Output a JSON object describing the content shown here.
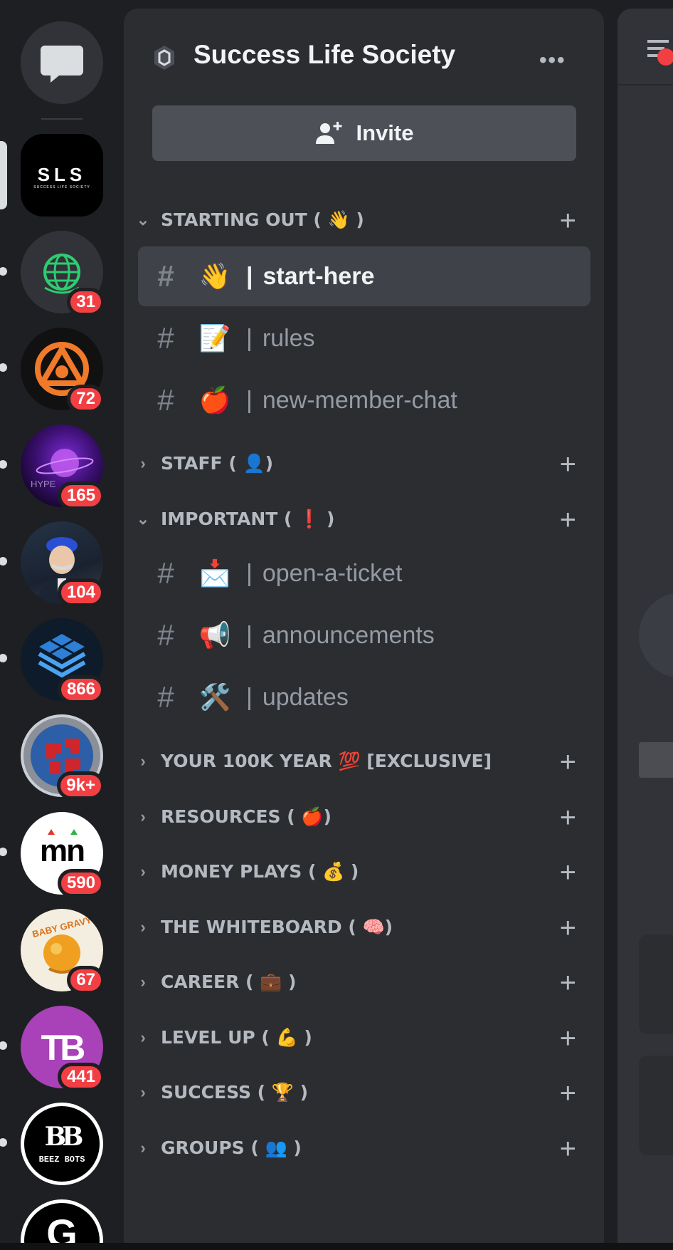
{
  "server": {
    "name": "Success Life Society",
    "invite_label": "Invite"
  },
  "rail": {
    "items": [
      {
        "name": "direct-messages",
        "badge": ""
      },
      {
        "name": "SLS",
        "title": "SLS",
        "subtitle": "SUCCESS LIFE SOCIETY",
        "badge": ""
      },
      {
        "name": "globe-server",
        "badge": "31"
      },
      {
        "name": "triangle-server",
        "badge": "72"
      },
      {
        "name": "hype-server",
        "label": "HYPE",
        "badge": "165"
      },
      {
        "name": "portrait-server",
        "badge": "104"
      },
      {
        "name": "cube-server",
        "badge": "866"
      },
      {
        "name": "red-logo-server",
        "badge": "9k+"
      },
      {
        "name": "mn-server",
        "label": "mn",
        "badge": "590"
      },
      {
        "name": "baby-gravy-server",
        "label": "BABY GRAVY",
        "badge": "67"
      },
      {
        "name": "tb-server",
        "label": "TB",
        "badge": "441"
      },
      {
        "name": "beez-bots-server",
        "label": "BEEZ BOTS",
        "badge": ""
      },
      {
        "name": "g-server",
        "label": "G",
        "badge": ""
      }
    ]
  },
  "categories": {
    "starting_out": {
      "label": "STARTING OUT ( 👋 )"
    },
    "staff": {
      "label": "STAFF ( 👤)"
    },
    "important": {
      "label": "IMPORTANT ( ❗ )"
    },
    "your100k": {
      "label": "YOUR 100K YEAR 💯 [EXCLUSIVE]"
    },
    "resources": {
      "label": "RESOURCES ( 🍎)"
    },
    "money_plays": {
      "label": "MONEY PLAYS ( 💰 )"
    },
    "whiteboard": {
      "label": "THE WHITEBOARD ( 🧠)"
    },
    "career": {
      "label": "CAREER ( 💼 )"
    },
    "level_up": {
      "label": "LEVEL UP (   💪 )"
    },
    "success": {
      "label": "SUCCESS (  🏆 )"
    },
    "groups": {
      "label": "GROUPS (  👥 )"
    }
  },
  "channels": {
    "start_here": {
      "emoji": "👋",
      "name": "start-here"
    },
    "rules": {
      "emoji": "📝",
      "name": "rules"
    },
    "new_member_chat": {
      "emoji": "🍎",
      "name": "new-member-chat"
    },
    "open_a_ticket": {
      "emoji": "📩",
      "name": "open-a-ticket"
    },
    "announcements": {
      "emoji": "📢",
      "name": "announcements"
    },
    "updates": {
      "emoji": "🛠️",
      "name": "updates"
    }
  },
  "symbols": {
    "hash": "#",
    "sep": "|",
    "plus": "+",
    "chev_open": "⌄",
    "chev_closed": "›",
    "more": "•••"
  },
  "colors": {
    "badge": "#f23f43",
    "panel": "#2b2d31",
    "selected": "#404249"
  }
}
